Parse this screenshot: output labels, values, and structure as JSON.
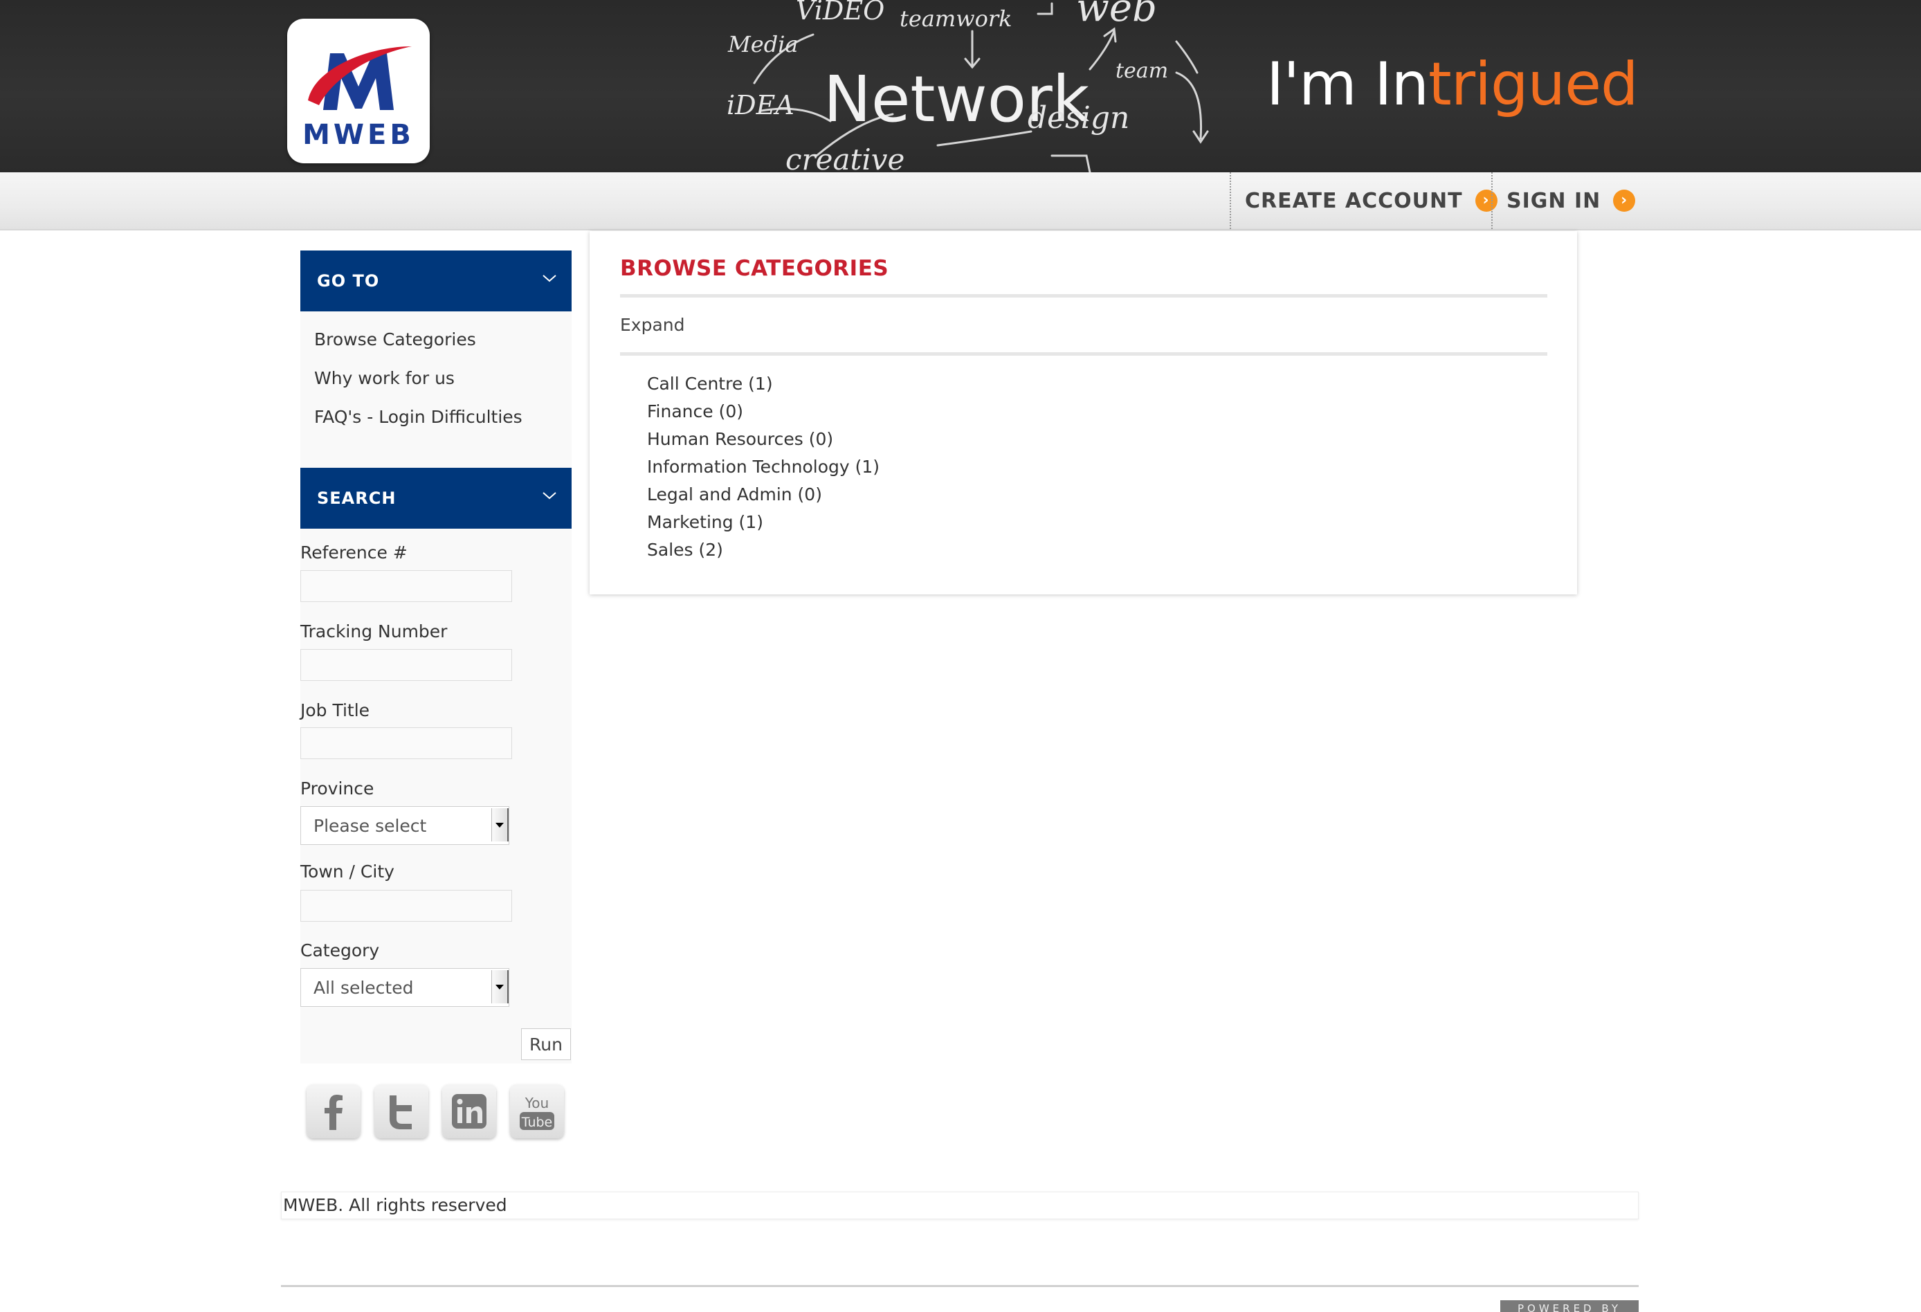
{
  "banner": {
    "logo_text": "MWEB",
    "tagline_white": "I'm In",
    "tagline_orange": "trigued",
    "chalk_words": [
      "ViDEO",
      "teamwork",
      "web",
      "Media",
      "iDEA",
      "Network",
      "team",
      "design",
      "creative"
    ],
    "colors": {
      "brand_blue": "#1b3d95",
      "brand_red": "#d6192d",
      "accent_orange": "#f26f21"
    }
  },
  "nav": {
    "create_account": "CREATE ACCOUNT",
    "sign_in": "SIGN IN",
    "arrow_icon": "chevron-right-circle-icon",
    "arrow_glyph": "›"
  },
  "sidebar": {
    "goto": {
      "heading": "GO TO",
      "items": [
        "Browse Categories",
        "Why work for us",
        "FAQ's - Login Difficulties"
      ]
    },
    "search": {
      "heading": "SEARCH",
      "reference_label": "Reference #",
      "reference_value": "",
      "tracking_label": "Tracking Number",
      "tracking_value": "",
      "job_title_label": "Job Title",
      "job_title_value": "",
      "province_label": "Province",
      "province_selected": "Please select",
      "town_label": "Town / City",
      "town_value": "",
      "category_label": "Category",
      "category_selected": "All selected",
      "run_label": "Run"
    },
    "social": [
      "facebook-icon",
      "twitter-icon",
      "linkedin-icon",
      "youtube-icon"
    ],
    "youtube_text": [
      "You",
      "Tube"
    ]
  },
  "main": {
    "title": "BROWSE CATEGORIES",
    "expand_label": "Expand",
    "categories": [
      "Call Centre (1)",
      "Finance (0)",
      "Human Resources (0)",
      "Information Technology (1)",
      "Legal and Admin (0)",
      "Marketing (1)",
      "Sales (2)"
    ],
    "accent_color": "#c8202f",
    "header_blue": "#00377b"
  },
  "footer": {
    "copyright": "MWEB. All rights reserved",
    "powered_by": "POWERED BY"
  }
}
